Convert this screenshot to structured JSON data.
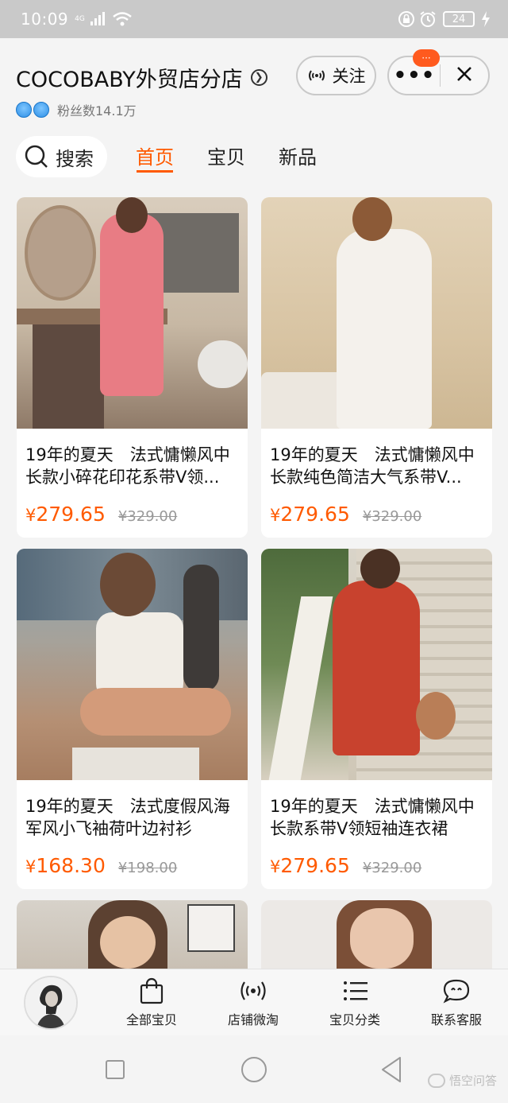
{
  "status_bar": {
    "time": "10:09",
    "network": "4G",
    "battery": "24"
  },
  "shop": {
    "name": "COCOBABY外贸店分店",
    "fans": "粉丝数14.1万",
    "follow_label": "关注"
  },
  "capsule": {
    "badge": "···"
  },
  "search": {
    "label": "搜索"
  },
  "tabs": [
    {
      "label": "首页",
      "active": true
    },
    {
      "label": "宝贝",
      "active": false
    },
    {
      "label": "新品",
      "active": false
    }
  ],
  "products": [
    {
      "title": "19年的夏天　法式慵懒风中长款小碎花印花系带V领...",
      "price": "279.65",
      "original_price": "¥329.00",
      "currency": "¥"
    },
    {
      "title": "19年的夏天　法式慵懒风中长款纯色简洁大气系带V...",
      "price": "279.65",
      "original_price": "¥329.00",
      "currency": "¥"
    },
    {
      "title": "19年的夏天　法式度假风海军风小飞袖荷叶边衬衫",
      "price": "168.30",
      "original_price": "¥198.00",
      "currency": "¥"
    },
    {
      "title": "19年的夏天　法式慵懒风中长款系带V领短袖连衣裙",
      "price": "279.65",
      "original_price": "¥329.00",
      "currency": "¥"
    }
  ],
  "bottom_bar": {
    "items": [
      {
        "label": "全部宝贝",
        "icon": "shopping-bag-icon"
      },
      {
        "label": "店铺微淘",
        "icon": "broadcast-icon"
      },
      {
        "label": "宝贝分类",
        "icon": "list-icon"
      },
      {
        "label": "联系客服",
        "icon": "chat-bot-icon"
      }
    ]
  },
  "watermark": {
    "text": "悟空问答"
  },
  "colors": {
    "accent": "#ff5a00",
    "badge": "#ff5a1e",
    "status_bar": "#c9c9c9"
  }
}
